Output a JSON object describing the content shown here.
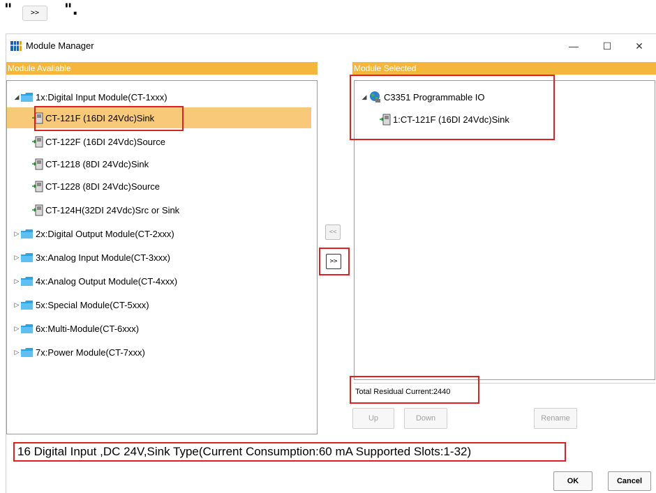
{
  "snippet": {
    "open_quote": "\"",
    "button_label": ">>",
    "close_quote": "\"."
  },
  "window": {
    "title": "Module Manager",
    "minimize": "—",
    "maximize": "☐",
    "close": "✕"
  },
  "left_panel": {
    "header": "Module Avaliable",
    "groups": [
      {
        "label": "1x:Digital Input Module(CT-1xxx)",
        "expanded": true,
        "children": [
          {
            "label": "CT-121F (16DI 24Vdc)Sink",
            "selected": true
          },
          {
            "label": "CT-122F (16DI 24Vdc)Source"
          },
          {
            "label": "CT-1218 (8DI 24Vdc)Sink"
          },
          {
            "label": "CT-1228 (8DI 24Vdc)Source"
          },
          {
            "label": "CT-124H(32DI 24Vdc)Src or Sink"
          }
        ]
      },
      {
        "label": "2x:Digital Output Module(CT-2xxx)",
        "expanded": false
      },
      {
        "label": "3x:Analog Input Module(CT-3xxx)",
        "expanded": false
      },
      {
        "label": "4x:Analog Output Module(CT-4xxx)",
        "expanded": false
      },
      {
        "label": "5x:Special Module(CT-5xxx)",
        "expanded": false
      },
      {
        "label": "6x:Multi-Module(CT-6xxx)",
        "expanded": false
      },
      {
        "label": "7x:Power Module(CT-7xxx)",
        "expanded": false
      }
    ]
  },
  "transfer": {
    "remove_label": "<<",
    "add_label": ">>"
  },
  "right_panel": {
    "header": "Module Selected",
    "root_label": "C3351 Programmable IO",
    "children": [
      "1:CT-121F (16DI 24Vdc)Sink"
    ],
    "residual_current": "Total Residual Current:2440"
  },
  "buttons": {
    "up": "Up",
    "down": "Down",
    "rename": "Rename",
    "ok": "OK",
    "cancel": "Cancel"
  },
  "description": "16 Digital Input ,DC 24V,Sink Type(Current Consumption:60 mA  Supported Slots:1-32)",
  "colors": {
    "header_bg": "#f3b83b",
    "selection_bg": "#f7c978",
    "highlight_box": "#e02020",
    "folder": "#2aa3e8"
  }
}
